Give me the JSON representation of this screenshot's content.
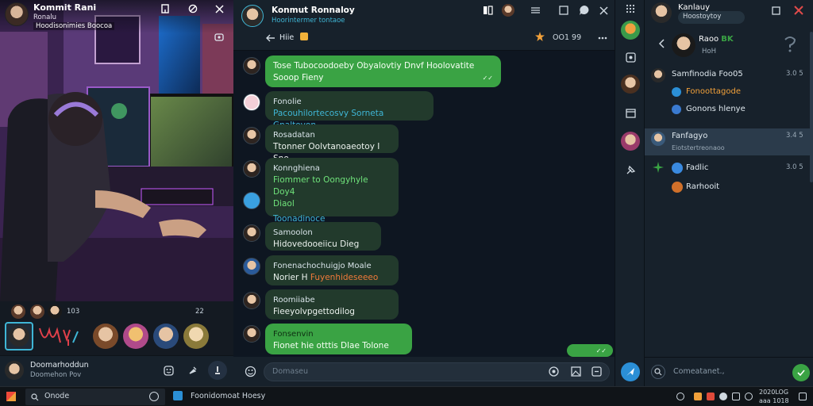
{
  "left_panel": {
    "header_name": "Kommit Rani",
    "header_sub1": "Ronalu",
    "header_sub2": "Hoodisonimies Boocoa",
    "strip_count": "103",
    "strip_count2": "22",
    "bottom_name": "Doomarhoddun",
    "bottom_sub": "Doomehon Pov"
  },
  "chat": {
    "title": "Konmut Ronnaloy",
    "subtitle": "Hoorintermer tontaoe",
    "sub_line": "Hiie",
    "header_count": "OO1 99",
    "messages": [
      {
        "id": "m1",
        "text": "Tose Tubocoodoeby Obyalovtiy Dnvf Hoolovatite Sooop Fieny"
      },
      {
        "id": "m2",
        "name": "Fonolie",
        "text": "Pacouhilortecosvy Sorneta Gnaltoyon"
      },
      {
        "id": "m3",
        "name": "Rosadatan",
        "text": "Ttonner Oolvtanoaeotoy I Sno..."
      },
      {
        "id": "m4",
        "name": "Konnghiena",
        "text": "Fiommer to Oongyhyle Doy4",
        "text2": "Diaol",
        "link": "Toonadinoce"
      },
      {
        "id": "m5",
        "name": "Samoolon",
        "text": "Hidovedooeiicu Dieg"
      },
      {
        "id": "m6",
        "name": "Fonenachochuigjo Moale",
        "text": "Norier H",
        "link": "Fuyenhideseeeo"
      },
      {
        "id": "m7",
        "name": "Roomiiabe",
        "text": "Fieeyolvpgettodilog"
      },
      {
        "id": "m8",
        "name": "Fonsenvin",
        "text": "Fionet hie otttis Dlae Tolone"
      },
      {
        "id": "m9",
        "text": ""
      }
    ],
    "input_placeholder": "Domaseu"
  },
  "right_panel": {
    "title": "Kanlauy",
    "subtitle": "Hoostoytoy",
    "profile_name": "Raoo",
    "profile_badge": "BK",
    "profile_sub": "HoH",
    "rows": [
      {
        "name": "Samfinodia Foo05",
        "time": "3.0 5"
      },
      {
        "name": "Fonoottagode",
        "time": ""
      },
      {
        "name": "Gonons hlenye",
        "time": ""
      },
      {
        "name": "Fanfagyo",
        "time": "3.4 5",
        "sub": "Eiotstertreonaoo"
      },
      {
        "name": "Fadlic",
        "time": "3.0 5"
      },
      {
        "name": "Rarhooit",
        "time": ""
      }
    ],
    "search_placeholder": "Comeatanet.,"
  },
  "taskbar": {
    "search_label": "Onode",
    "app_label": "Foonidomoat Hoesy",
    "clock_time": "2020LOG",
    "clock_date": "aaa 1018"
  },
  "colors": {
    "accent": "#3aa344",
    "link": "#3fb6d6",
    "app_bg": "#17212b",
    "chat_bg": "#0e1621"
  }
}
